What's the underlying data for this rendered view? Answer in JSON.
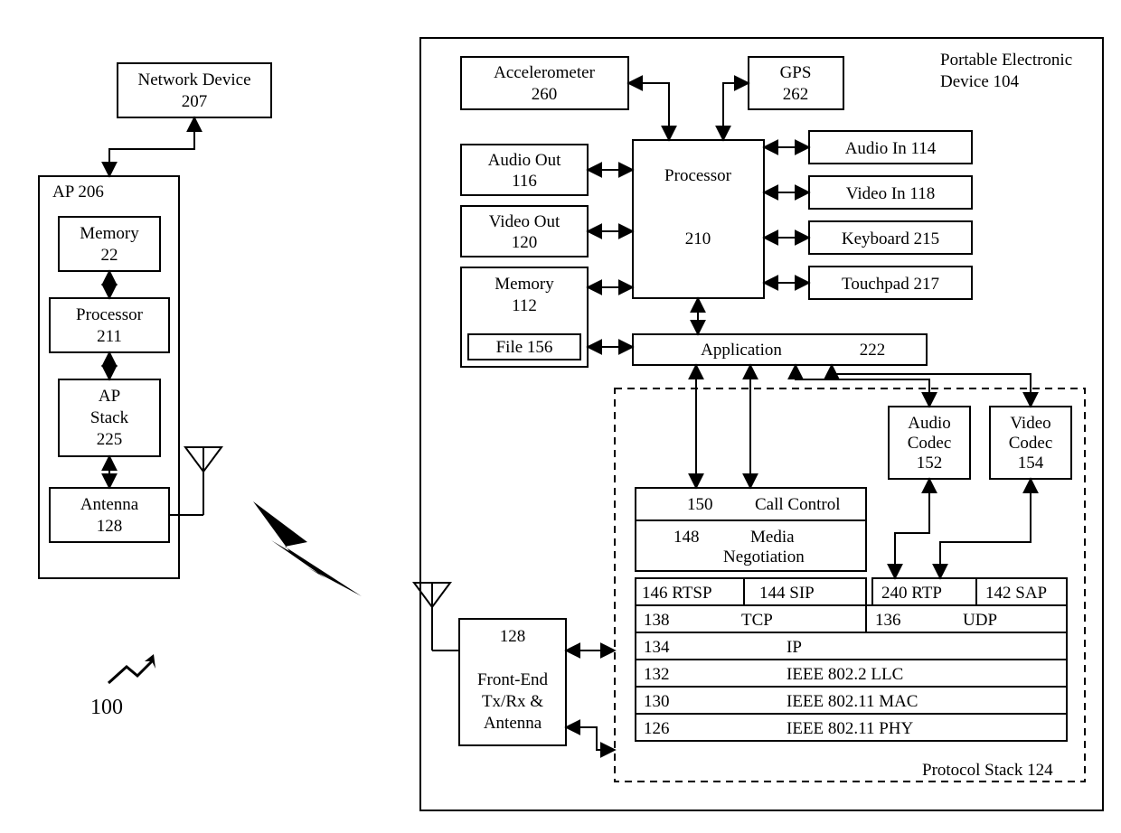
{
  "figure_ref": "100",
  "network_device": {
    "label": "Network Device",
    "num": "207"
  },
  "ap": {
    "title": "AP",
    "title_num": "206",
    "memory": {
      "label": "Memory",
      "num": "22"
    },
    "processor": {
      "label": "Processor",
      "num": "211"
    },
    "stack": {
      "label": "AP\nStack",
      "num": "225"
    },
    "antenna": {
      "label": "Antenna",
      "num": "128"
    }
  },
  "ped": {
    "title": "Portable Electronic\nDevice 104",
    "accelerometer": {
      "label": "Accelerometer",
      "num": "260"
    },
    "gps": {
      "label": "GPS",
      "num": "262"
    },
    "processor": {
      "label": "Processor",
      "num": "210"
    },
    "audio_out": {
      "label": "Audio Out",
      "num": "116"
    },
    "video_out": {
      "label": "Video Out",
      "num": "120"
    },
    "memory": {
      "label": "Memory",
      "num": "112"
    },
    "file": {
      "label": "File",
      "num": "156"
    },
    "audio_in": {
      "label": "Audio In",
      "num": "114"
    },
    "video_in": {
      "label": "Video In",
      "num": "118"
    },
    "keyboard": {
      "label": "Keyboard",
      "num": "215"
    },
    "touchpad": {
      "label": "Touchpad",
      "num": "217"
    },
    "application": {
      "label": "Application",
      "num": "222"
    },
    "frontend": {
      "num": "128",
      "label": "Front-End\nTx/Rx &\nAntenna"
    }
  },
  "stack": {
    "title": "Protocol Stack",
    "title_num": "124",
    "audio_codec": {
      "label": "Audio\nCodec",
      "num": "152"
    },
    "video_codec": {
      "label": "Video\nCodec",
      "num": "154"
    },
    "call_control": {
      "num": "150",
      "label": "Call Control"
    },
    "media_neg": {
      "num": "148",
      "label": "Media\nNegotiation"
    },
    "rtsp": {
      "num": "146",
      "label": "RTSP"
    },
    "sip": {
      "num": "144",
      "label": "SIP"
    },
    "rtp": {
      "num": "240",
      "label": "RTP"
    },
    "sap": {
      "num": "142",
      "label": "SAP"
    },
    "tcp": {
      "num": "138",
      "label": "TCP"
    },
    "udp": {
      "num": "136",
      "label": "UDP"
    },
    "ip": {
      "num": "134",
      "label": "IP"
    },
    "llc": {
      "num": "132",
      "label": "IEEE 802.2 LLC"
    },
    "mac": {
      "num": "130",
      "label": "IEEE 802.11 MAC"
    },
    "phy": {
      "num": "126",
      "label": "IEEE 802.11 PHY"
    }
  }
}
